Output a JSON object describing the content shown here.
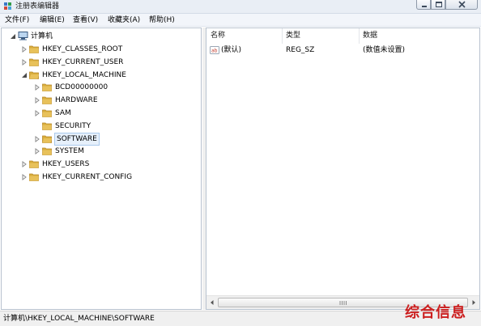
{
  "window": {
    "title": "注册表编辑器"
  },
  "menu": [
    "文件(F)",
    "编辑(E)",
    "查看(V)",
    "收藏夹(A)",
    "帮助(H)"
  ],
  "tree": {
    "root": "计算机",
    "hives": [
      {
        "label": "HKEY_CLASSES_ROOT"
      },
      {
        "label": "HKEY_CURRENT_USER"
      },
      {
        "label": "HKEY_LOCAL_MACHINE",
        "expanded": true
      },
      {
        "label": "BCD00000000"
      },
      {
        "label": "HARDWARE"
      },
      {
        "label": "SAM"
      },
      {
        "label": "SECURITY"
      },
      {
        "label": "SOFTWARE",
        "selected": true
      },
      {
        "label": "SYSTEM"
      },
      {
        "label": "HKEY_USERS"
      },
      {
        "label": "HKEY_CURRENT_CONFIG"
      }
    ]
  },
  "list": {
    "columns": [
      "名称",
      "类型",
      "数据"
    ],
    "rows": [
      {
        "name": "(默认)",
        "type": "REG_SZ",
        "data": "(数值未设置)"
      }
    ]
  },
  "status": {
    "path": "计算机\\HKEY_LOCAL_MACHINE\\SOFTWARE"
  },
  "watermark": "综合信息",
  "colors": {
    "folder": "#e8c15a",
    "selection": "#e6f0fb",
    "watermark": "#cc1f1f"
  }
}
